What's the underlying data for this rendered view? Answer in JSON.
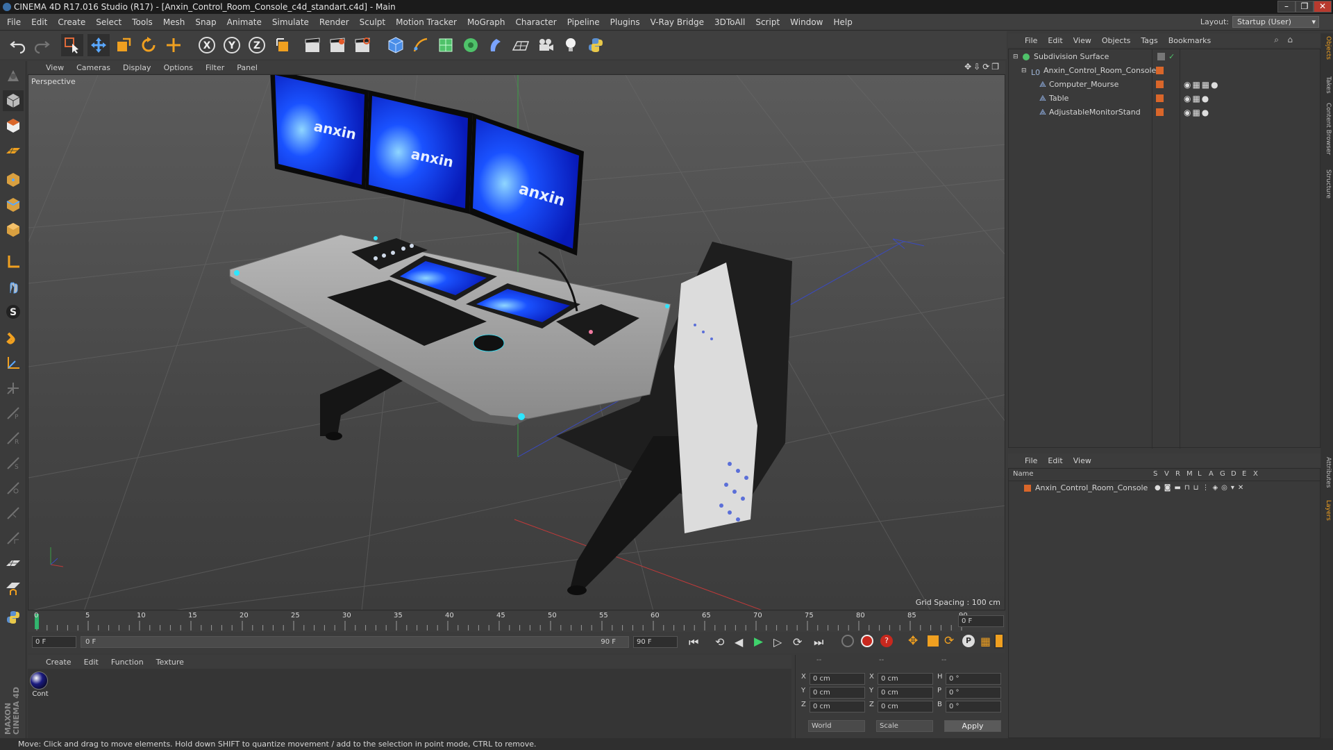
{
  "window": {
    "title": "CINEMA 4D R17.016 Studio (R17) - [Anxin_Control_Room_Console_c4d_standart.c4d] - Main",
    "controls": [
      "–",
      "❐",
      "✕"
    ]
  },
  "menu": [
    "File",
    "Edit",
    "Create",
    "Select",
    "Tools",
    "Mesh",
    "Snap",
    "Animate",
    "Simulate",
    "Render",
    "Sculpt",
    "Motion Tracker",
    "MoGraph",
    "Character",
    "Pipeline",
    "Plugins",
    "V-Ray Bridge",
    "3DToAll",
    "Script",
    "Window",
    "Help"
  ],
  "layout": {
    "label": "Layout:",
    "value": "Startup (User)"
  },
  "toolbar": {
    "axis_x": "X",
    "axis_y": "Y",
    "axis_z": "Z"
  },
  "left_tools": {
    "smooth_label": "S"
  },
  "viewport": {
    "menu": [
      "View",
      "Cameras",
      "Display",
      "Options",
      "Filter",
      "Panel"
    ],
    "label": "Perspective",
    "grid_spacing": "Grid Spacing : 100 cm",
    "screen_logo": "anxin"
  },
  "timeline": {
    "ticks": [
      "0",
      "5",
      "10",
      "15",
      "20",
      "25",
      "30",
      "35",
      "40",
      "45",
      "50",
      "55",
      "60",
      "65",
      "70",
      "75",
      "80",
      "85",
      "90"
    ],
    "current_frame": "0 F",
    "start_field": "0 F",
    "range_start": "0 F",
    "range_end": "90 F",
    "end_field": "90 F"
  },
  "materials": {
    "menu": [
      "Create",
      "Edit",
      "Function",
      "Texture"
    ],
    "items": [
      {
        "label": "Cont"
      }
    ]
  },
  "coords": {
    "header": [
      "--",
      "--",
      "--"
    ],
    "rows": [
      {
        "a": "X",
        "av": "0 cm",
        "b": "X",
        "bv": "0 cm",
        "c": "H",
        "cv": "0 °"
      },
      {
        "a": "Y",
        "av": "0 cm",
        "b": "Y",
        "bv": "0 cm",
        "c": "P",
        "cv": "0 °"
      },
      {
        "a": "Z",
        "av": "0 cm",
        "b": "Z",
        "bv": "0 cm",
        "c": "B",
        "cv": "0 °"
      }
    ],
    "mode1": "World",
    "mode2": "Scale",
    "apply": "Apply"
  },
  "objects": {
    "menu": [
      "File",
      "Edit",
      "View",
      "Objects",
      "Tags",
      "Bookmarks"
    ],
    "items": [
      {
        "name": "Subdivision Surface",
        "indent": 0
      },
      {
        "name": "Anxin_Control_Room_Console",
        "indent": 1
      },
      {
        "name": "Computer_Mourse",
        "indent": 2
      },
      {
        "name": "Table",
        "indent": 2
      },
      {
        "name": "AdjustableMonitorStand",
        "indent": 2
      }
    ]
  },
  "layers": {
    "menu": [
      "File",
      "Edit",
      "View"
    ],
    "name_header": "Name",
    "flag_headers": [
      "S",
      "V",
      "R",
      "M",
      "L",
      "A",
      "G",
      "D",
      "E",
      "X"
    ],
    "items": [
      {
        "name": "Anxin_Control_Room_Console"
      }
    ]
  },
  "right_tabs": [
    "Objects",
    "Takes",
    "Content Browser",
    "Structure",
    "Attributes",
    "Layers"
  ],
  "branding": "MAXON CINEMA 4D",
  "status": "Move: Click and drag to move elements. Hold down SHIFT to quantize movement / add to the selection in point mode, CTRL to remove.",
  "colors": {
    "accent_orange": "#d9662a",
    "selection_blue": "#2f5e94",
    "screen_blue": "#0c2fd6",
    "led_cyan": "#2de6ff"
  }
}
